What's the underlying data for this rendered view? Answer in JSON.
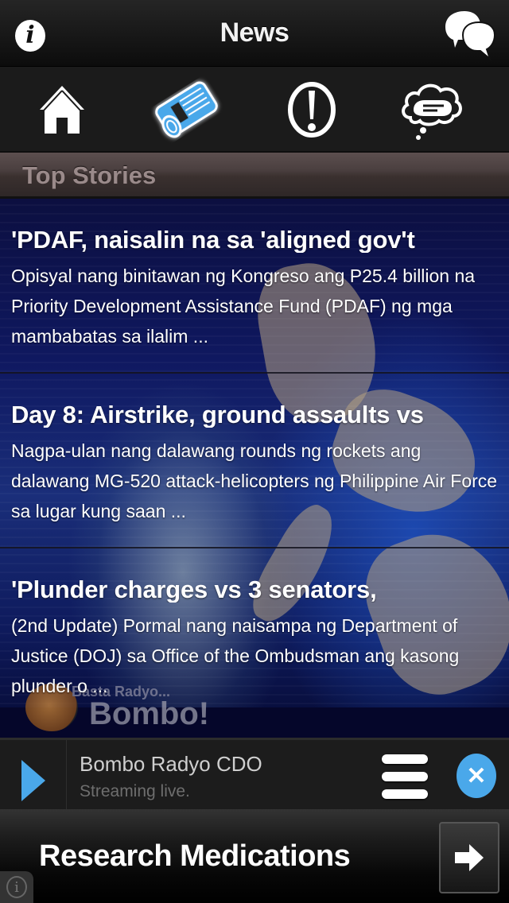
{
  "header": {
    "title": "News",
    "left_icon": "info-icon",
    "right_icon": "chat-bubbles-icon"
  },
  "toolbar": {
    "items": [
      {
        "icon": "home-icon",
        "active": false
      },
      {
        "icon": "newspaper-icon",
        "active": true
      },
      {
        "icon": "alert-icon",
        "active": false
      },
      {
        "icon": "thought-cloud-icon",
        "active": false
      }
    ],
    "active_color": "#4aa8ea"
  },
  "section": {
    "title": "Top Stories"
  },
  "stories": [
    {
      "headline": "'PDAF, naisalin na sa 'aligned gov't",
      "summary": "Opisyal nang binitawan ng Kongreso ang P25.4 billion na Priority Development Assistance Fund (PDAF) ng mga mambabatas sa ilalim ..."
    },
    {
      "headline": "Day 8: Airstrike, ground assaults vs",
      "summary": "Nagpa-ulan nang dalawang rounds ng rockets ang dalawang MG-520 attack-helicopters ng Philippine Air Force sa lugar kung saan ..."
    },
    {
      "headline": "'Plunder charges vs 3 senators,",
      "summary": "(2nd Update) Pormal nang naisampa ng Department of Justice (DOJ) sa Office of the Ombudsman ang kasong plunder o ..."
    }
  ],
  "background_logo": {
    "tagline": "Basta Radyo...",
    "brand": "Bombo!"
  },
  "player": {
    "station": "Bombo Radyo CDO",
    "status": "Streaming live.",
    "accent": "#4aa8ea",
    "close_glyph": "✕"
  },
  "ad": {
    "text": "Research Medications",
    "info_glyph": "i"
  }
}
